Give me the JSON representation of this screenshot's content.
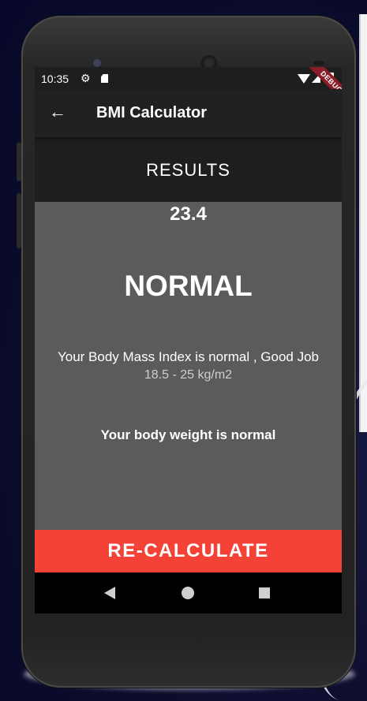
{
  "status_bar": {
    "time": "10:35",
    "icons": [
      "gear-icon",
      "sd-card-icon",
      "wifi-icon",
      "signal-icon",
      "battery-icon"
    ],
    "debug_label": "DEBUG"
  },
  "app_bar": {
    "back_icon": "arrow-left-icon",
    "title": "BMI Calculator"
  },
  "results": {
    "heading": "RESULTS",
    "bmi_value": "23.4",
    "category": "NORMAL",
    "interpretation": "Your Body Mass Index is normal , Good Job",
    "range": "18.5 - 25 kg/m2",
    "note": "Your body weight is normal"
  },
  "actions": {
    "recalculate_label": "RE-CALCULATE"
  },
  "nav_bar": {
    "icons": [
      "back-triangle-icon",
      "home-circle-icon",
      "recent-square-icon"
    ]
  },
  "colors": {
    "accent": "#f44336",
    "card": "#5b5b5b",
    "background": "#1e1e1e",
    "app_bar": "#212121"
  }
}
